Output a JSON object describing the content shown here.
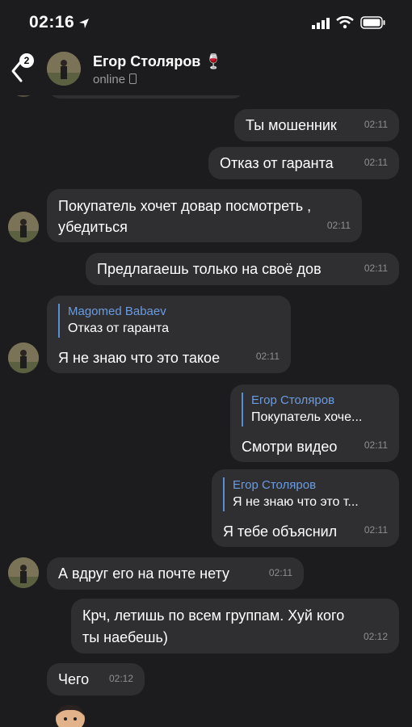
{
  "status_bar": {
    "time": "02:16"
  },
  "header": {
    "back_badge": "2",
    "contact_name": "Егор Столяров",
    "contact_emoji": "🍷",
    "status": "online"
  },
  "messages": [
    {
      "text": "Ты мошенник",
      "time": "02:11"
    },
    {
      "text": "Отказ от гаранта",
      "time": "02:11"
    },
    {
      "text_line1": "Покупатель хочет довар посмотреть ,",
      "text_line2": "убедиться",
      "time": "02:11"
    },
    {
      "text": "Предлагаешь только на своё дов",
      "time": "02:11"
    },
    {
      "reply_name": "Magomed Babaev",
      "reply_text": "Отказ от гаранта",
      "text": "Я не знаю что это такое",
      "time": "02:11"
    },
    {
      "reply_name": "Егор Столяров",
      "reply_text": "Покупатель хоче...",
      "text": "Смотри видео",
      "time": "02:11"
    },
    {
      "reply_name": "Егор Столяров",
      "reply_text": "Я не знаю что это т...",
      "text": "Я тебе объяснил",
      "time": "02:11"
    },
    {
      "text": "А вдруг его на почте нету",
      "time": "02:11"
    },
    {
      "text_line1": "Крч, летишь по всем группам. Хуй кого",
      "text_line2": "ты наебешь)",
      "time": "02:12"
    },
    {
      "text": "Чего",
      "time": "02:12"
    }
  ]
}
